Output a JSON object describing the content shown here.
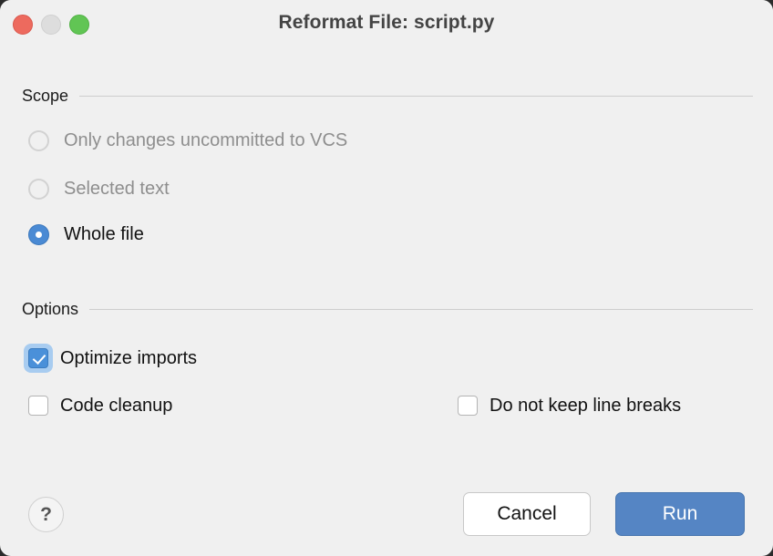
{
  "window": {
    "title": "Reformat File: script.py",
    "background_color": "#f0f0f0",
    "traffic_lights": [
      {
        "name": "close",
        "color": "#ed6a5e"
      },
      {
        "name": "minimize",
        "color": "#dddddd"
      },
      {
        "name": "zoom",
        "color": "#61c554"
      }
    ]
  },
  "scope": {
    "header": "Scope",
    "options": [
      {
        "label": "Only changes uncommitted to VCS",
        "selected": false,
        "enabled": false
      },
      {
        "label": "Selected text",
        "selected": false,
        "enabled": false
      },
      {
        "label": "Whole file",
        "selected": true,
        "enabled": true
      }
    ]
  },
  "options": {
    "header": "Options",
    "checkboxes": [
      {
        "label": "Optimize imports",
        "checked": true,
        "focused": true
      },
      {
        "label": "Code cleanup",
        "checked": false,
        "focused": false
      },
      {
        "label": "Do not keep line breaks",
        "checked": false,
        "focused": false
      }
    ]
  },
  "footer": {
    "help_label": "?",
    "cancel_label": "Cancel",
    "run_label": "Run",
    "run_accent_color": "#5585c4"
  }
}
